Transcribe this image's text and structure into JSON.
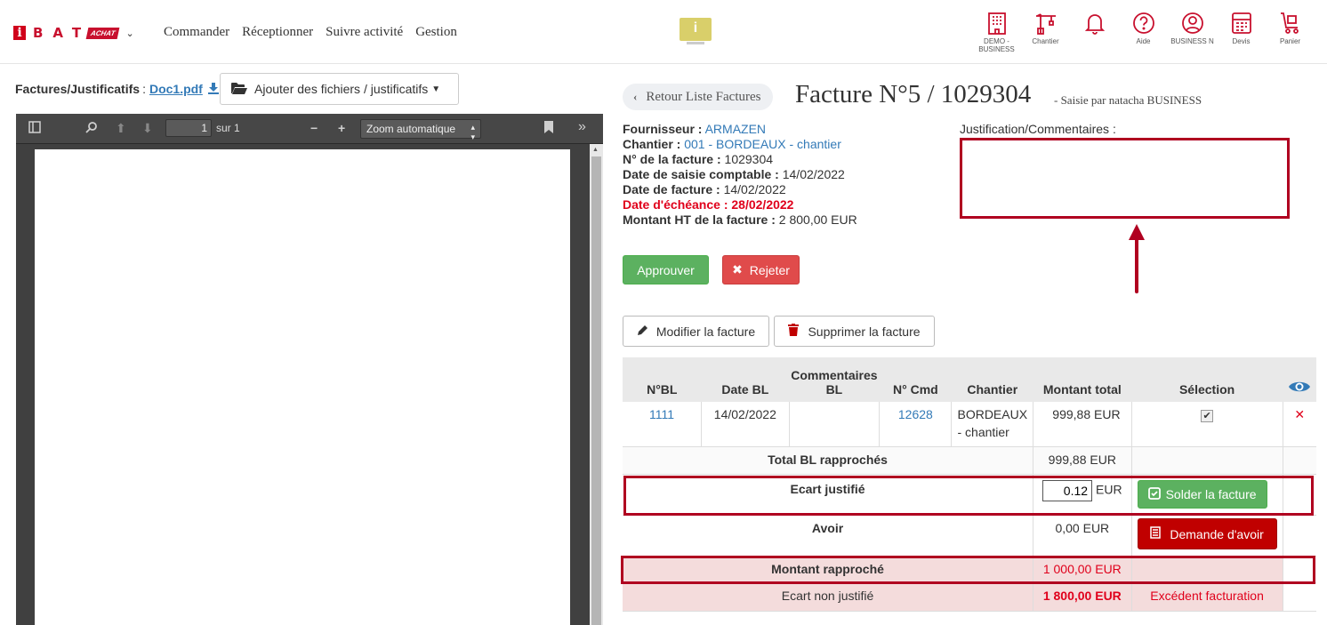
{
  "nav": {
    "logo_letter": "i",
    "logo_brand": "BAT",
    "logo_module": "ACHAT",
    "menu": [
      "Commander",
      "Réceptionner",
      "Suivre activité",
      "Gestion"
    ],
    "center_badge": "i",
    "icons": [
      {
        "icon": "building-icon",
        "label": "DEMO - BUSINESS"
      },
      {
        "icon": "crane-icon",
        "label": "Chantier"
      },
      {
        "icon": "bell-icon",
        "label": ""
      },
      {
        "icon": "help-icon",
        "label": "Aide"
      },
      {
        "icon": "user-icon",
        "label": "BUSINESS N"
      },
      {
        "icon": "calculator-icon",
        "label": "Devis"
      },
      {
        "icon": "cart-icon",
        "label": "Panier"
      }
    ]
  },
  "left": {
    "title": "Factures/Justificatifs",
    "separator": ":",
    "doc_link": "Doc1.pdf",
    "add_files": "Ajouter des fichiers / justificatifs",
    "pdf": {
      "page": "1",
      "of_label": "sur 1",
      "zoom": "Zoom automatique"
    }
  },
  "invoice": {
    "back_label": "Retour Liste Factures",
    "title": "Facture N°5 / 1029304",
    "subtitle": "- Saisie par natacha BUSINESS",
    "fields": {
      "supplier_label": "Fournisseur :",
      "supplier": "ARMAZEN",
      "site_label": "Chantier :",
      "site": "001 - BORDEAUX - chantier",
      "number_label": "N° de la facture :",
      "number": "1029304",
      "entry_date_label": "Date de saisie comptable :",
      "entry_date": "14/02/2022",
      "invoice_date_label": "Date de facture :",
      "invoice_date": "14/02/2022",
      "due_label": "Date d'échéance :",
      "due_date": "28/02/2022",
      "amount_label": "Montant HT de la facture :",
      "amount": "2 800,00 EUR"
    },
    "comment_label": "Justification/Commentaires :",
    "comment_value": "",
    "approve": "Approuver",
    "reject": "Rejeter",
    "edit": "Modifier la facture",
    "delete": "Supprimer la facture"
  },
  "table": {
    "headers": {
      "bl": "N°BL",
      "date": "Date BL",
      "comments_top": "Commentaires",
      "comments_bottom": "BL",
      "cmd": "N° Cmd",
      "site": "Chantier",
      "total": "Montant total",
      "selection": "Sélection"
    },
    "row": {
      "bl": "1111",
      "date": "14/02/2022",
      "comment": "",
      "cmd": "12628",
      "site_line1": "BORDEAUX",
      "site_line2": "- chantier",
      "total": "999,88 EUR",
      "checkmark": "✔",
      "remove": "✕"
    },
    "total_bl_label": "Total BL rapprochés",
    "total_bl": "999,88 EUR",
    "ecart_label": "Ecart justifié",
    "ecart_value": "0.12",
    "ecart_unit": "EUR",
    "solder": "Solder la facture",
    "avoir_label": "Avoir",
    "avoir": "0,00 EUR",
    "avoir_btn": "Demande d'avoir",
    "rapproche_label": "Montant rapproché",
    "rapproche": "1 000,00 EUR",
    "non_justifie_label": "Ecart non justifié",
    "non_justifie": "1 800,00 EUR",
    "excedent": "Excédent facturation"
  },
  "colors": {
    "brand": "#c8102e",
    "highlight": "#b00020",
    "link": "#337ab7"
  }
}
